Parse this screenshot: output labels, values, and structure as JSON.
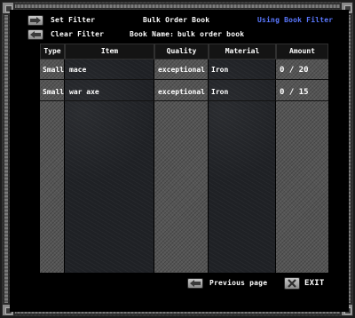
{
  "header": {
    "set_filter": "Set Filter",
    "clear_filter": "Clear Filter",
    "title": "Bulk Order Book",
    "book_name_label": "Book Name:",
    "book_name": "bulk order book",
    "filter_status": "Using Book Filter"
  },
  "table": {
    "columns": [
      "Type",
      "Item",
      "Quality",
      "Material",
      "Amount"
    ],
    "rows": [
      {
        "type": "Small",
        "item": "mace",
        "quality": "exceptional",
        "material": "Iron",
        "amount": "0 / 20"
      },
      {
        "type": "Small",
        "item": "war axe",
        "quality": "exceptional",
        "material": "Iron",
        "amount": "0 / 15"
      }
    ]
  },
  "footer": {
    "previous_page": "Previous page",
    "exit": "EXIT"
  },
  "colors": {
    "text": "#ffffff",
    "filter_status": "#5a78ff",
    "background": "#000000"
  },
  "icons": {
    "set_filter": "arrow-right-icon",
    "clear_filter": "arrow-left-icon",
    "previous_page": "arrow-left-icon",
    "exit": "close-x-icon"
  }
}
